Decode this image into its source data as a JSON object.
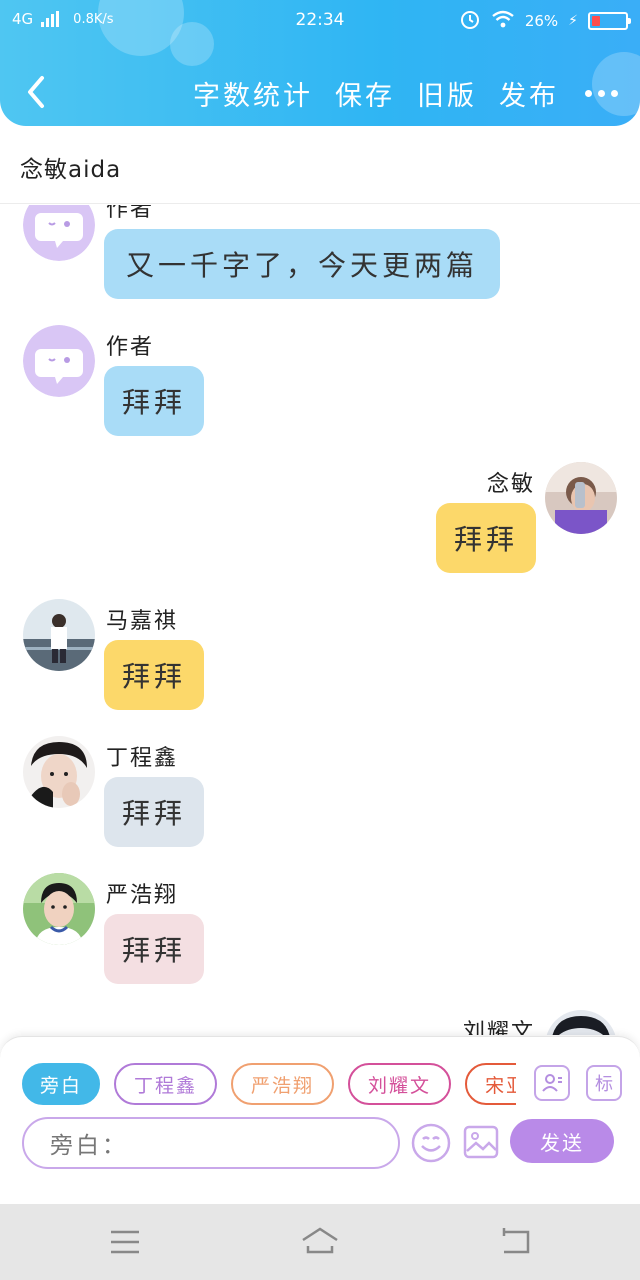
{
  "status_bar": {
    "network": "4G",
    "speed": "0.8K/s",
    "time": "22:34",
    "battery": "26%",
    "battery_level": 0.26
  },
  "toolbar": {
    "actions": [
      "字数统计",
      "保存",
      "旧版",
      "发布"
    ]
  },
  "title": "念敏aida",
  "messages": [
    {
      "sender": "作者",
      "text": "又一千字了，今天更两篇",
      "side": "left",
      "bubble_color": "#a9dcf7",
      "avatar": "ghost-icon"
    },
    {
      "sender": "作者",
      "text": "拜拜",
      "side": "left",
      "bubble_color": "#a9dcf7",
      "avatar": "ghost-icon"
    },
    {
      "sender": "念敏",
      "text": "拜拜",
      "side": "right",
      "bubble_color": "#fcd86a",
      "avatar": "photo"
    },
    {
      "sender": "马嘉祺",
      "text": "拜拜",
      "side": "left",
      "bubble_color": "#fcd86a",
      "avatar": "photo"
    },
    {
      "sender": "丁程鑫",
      "text": "拜拜",
      "side": "left",
      "bubble_color": "#dde5ed",
      "avatar": "photo"
    },
    {
      "sender": "严浩翔",
      "text": "拜拜",
      "side": "left",
      "bubble_color": "#f4dfe2",
      "avatar": "photo"
    },
    {
      "sender": "刘耀文",
      "text": "",
      "side": "right",
      "bubble_color": "",
      "avatar": "photo"
    }
  ],
  "input": {
    "roles": [
      {
        "label": "旁白",
        "color": "#42b8e8",
        "filled": true
      },
      {
        "label": "丁程鑫",
        "color": "#b07ad8",
        "filled": false
      },
      {
        "label": "严浩翔",
        "color": "#f0a070",
        "filled": false
      },
      {
        "label": "刘耀文",
        "color": "#d4509a",
        "filled": false
      },
      {
        "label": "宋亚轩",
        "color": "#e45a3a",
        "filled": false
      }
    ],
    "mark_label": "标",
    "placeholder": "旁白：",
    "send_label": "发送"
  }
}
